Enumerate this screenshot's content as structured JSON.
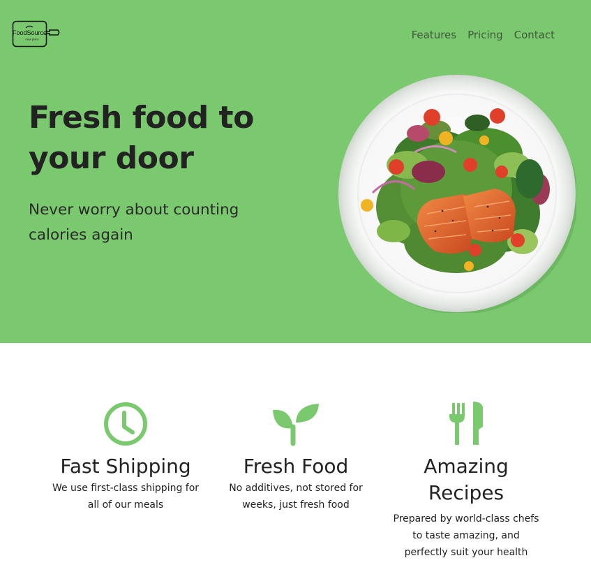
{
  "brand": {
    "logo_text": "FoodSource",
    "logo_subtext": "meal plans"
  },
  "nav": {
    "items": [
      {
        "label": "Features"
      },
      {
        "label": "Pricing"
      },
      {
        "label": "Contact"
      }
    ]
  },
  "hero": {
    "headline": "Fresh food to your door",
    "subhead": "Never worry about counting calories again",
    "image": "salmon-salad-plate"
  },
  "features": [
    {
      "icon": "clock-icon",
      "title": "Fast Shipping",
      "text": "We use first-class shipping for all of our meals"
    },
    {
      "icon": "sprout-icon",
      "title": "Fresh Food",
      "text": "No additives, not stored for weeks, just fresh food"
    },
    {
      "icon": "fork-knife-icon",
      "title": "Amazing Recipes",
      "text": "Prepared by world-class chefs to taste amazing, and perfectly suit your health"
    }
  ],
  "colors": {
    "hero_bg": "#7bc96f",
    "icon_green": "#7bc96f",
    "text_dark": "#222222",
    "nav_text": "#3f5a3b"
  }
}
